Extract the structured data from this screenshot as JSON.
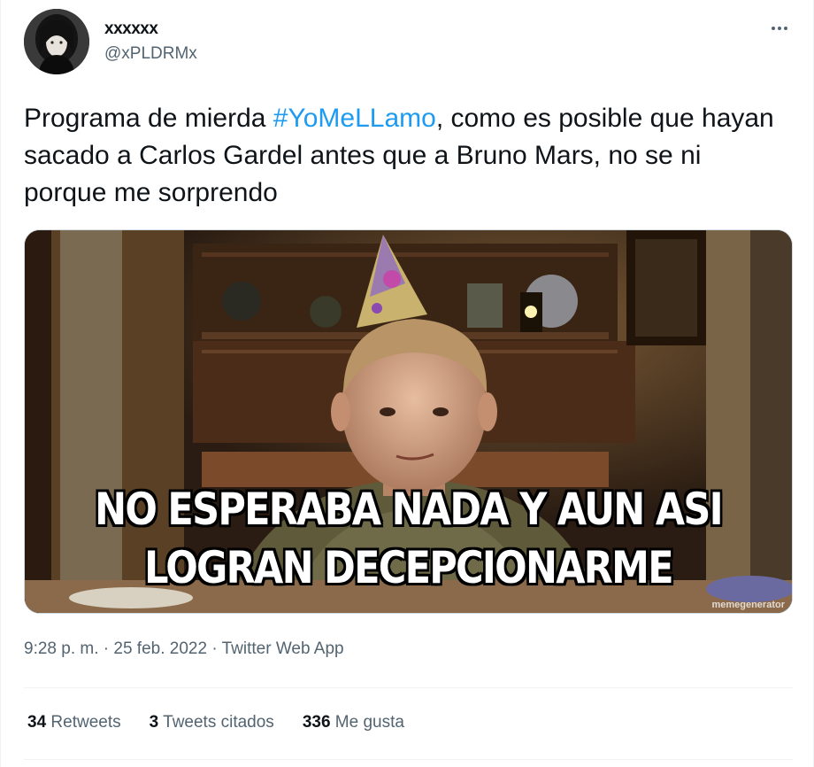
{
  "author": {
    "display_name": "xxxxxx",
    "handle": "@xPLDRMx",
    "avatar_icon": "profile-avatar"
  },
  "more_icon": "more-options-icon",
  "tweet": {
    "text_before": "Programa de mierda ",
    "hashtag": "#YoMeLLamo",
    "text_after": ", como es posible que hayan sacado a Carlos Gardel antes que a Bruno Mars, no se ni porque me sorprendo"
  },
  "media": {
    "caption_line1": "NO ESPERABA NADA Y AUN ASI",
    "caption_line2": "LOGRAN DECEPCIONARME",
    "watermark": "memegenerator"
  },
  "meta": {
    "time": "9:28 p. m.",
    "separator": " · ",
    "date": "25 feb. 2022",
    "source": "Twitter Web App"
  },
  "stats": {
    "retweets_count": "34",
    "retweets_label": "Retweets",
    "quotes_count": "3",
    "quotes_label": "Tweets citados",
    "likes_count": "336",
    "likes_label": "Me gusta"
  },
  "colors": {
    "link": "#1d9bf0",
    "secondary_text": "#536471",
    "primary_text": "#0f1419"
  }
}
